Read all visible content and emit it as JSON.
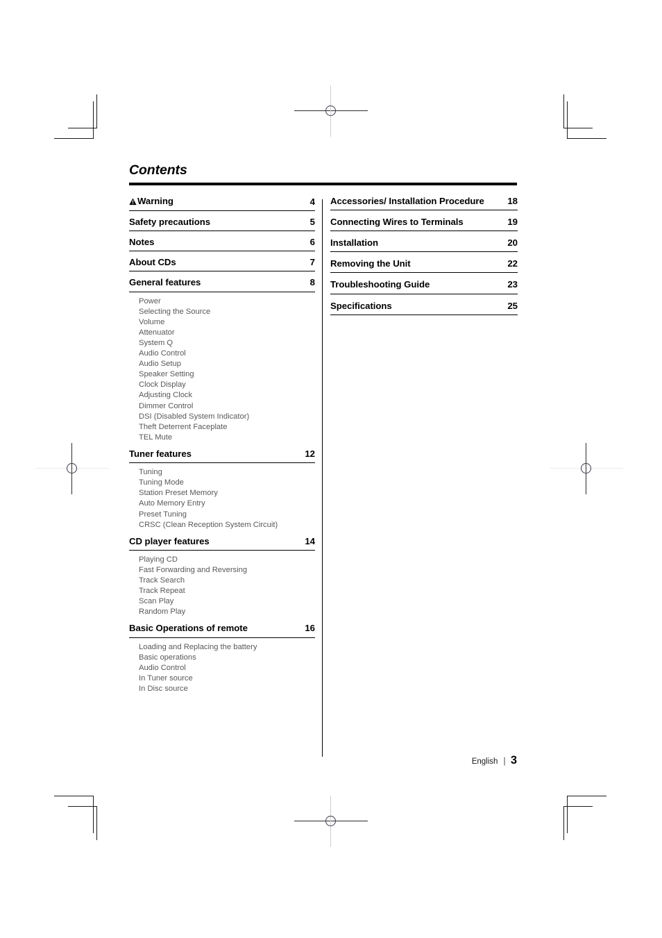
{
  "document": {
    "title": "Contents",
    "warning_icon": "warning-triangle-icon"
  },
  "left_column": {
    "sections": [
      {
        "label": "Warning",
        "page": "4",
        "has_warning_icon": true,
        "subs": []
      },
      {
        "label": "Safety precautions",
        "page": "5",
        "subs": []
      },
      {
        "label": "Notes",
        "page": "6",
        "subs": []
      },
      {
        "label": "About CDs",
        "page": "7",
        "subs": []
      },
      {
        "label": "General features",
        "page": "8",
        "subs": [
          "Power",
          "Selecting the Source",
          "Volume",
          "Attenuator",
          "System Q",
          "Audio Control",
          "Audio Setup",
          "Speaker Setting",
          "Clock Display",
          "Adjusting Clock",
          "Dimmer Control",
          "DSI (Disabled System Indicator)",
          "Theft Deterrent Faceplate",
          "TEL Mute"
        ]
      },
      {
        "label": "Tuner features",
        "page": "12",
        "subs": [
          "Tuning",
          "Tuning Mode",
          "Station Preset Memory",
          "Auto Memory Entry",
          "Preset Tuning",
          "CRSC (Clean Reception System Circuit)"
        ]
      },
      {
        "label": "CD player features",
        "page": "14",
        "subs": [
          "Playing CD",
          "Fast Forwarding and Reversing",
          "Track Search",
          "Track Repeat",
          "Scan Play",
          "Random Play"
        ]
      },
      {
        "label": "Basic Operations of remote",
        "page": "16",
        "subs": [
          "Loading and Replacing the battery",
          "Basic operations",
          "Audio Control",
          "In Tuner source",
          "In Disc source"
        ]
      }
    ]
  },
  "right_column": {
    "sections": [
      {
        "label": "Accessories/ Installation Procedure",
        "page": "18",
        "nogap": true
      },
      {
        "label": "Connecting Wires to Terminals",
        "page": "19"
      },
      {
        "label": "Installation",
        "page": "20"
      },
      {
        "label": "Removing the Unit",
        "page": "22"
      },
      {
        "label": "Troubleshooting Guide",
        "page": "23"
      },
      {
        "label": "Specifications",
        "page": "25"
      }
    ]
  },
  "footer": {
    "language": "English",
    "separator": "|",
    "page_number": "3"
  },
  "colors": {
    "text": "#000000",
    "sub_text": "#58585a",
    "rule": "#000000"
  }
}
